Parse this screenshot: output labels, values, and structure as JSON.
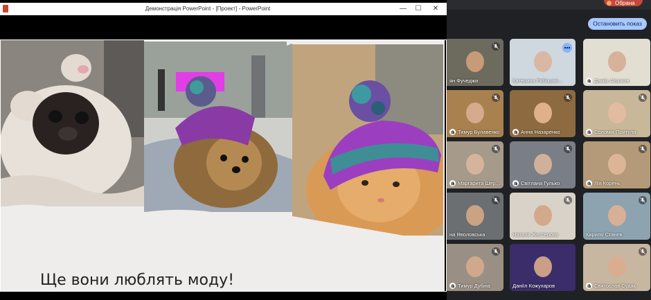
{
  "browser": {
    "account_label": "Обрана"
  },
  "ppt": {
    "window_title": "Демонстрація PowerPoint - [Проект] - PowerPoint",
    "minimize": "—",
    "maximize": "☐",
    "close": "✕",
    "slide_caption": "Ще вони люблять моду!"
  },
  "meet": {
    "stop_button": "Остановить показ",
    "participants": [
      {
        "name": "ян Фучеджи",
        "hand": false,
        "mic_off": true,
        "active": false,
        "bg": "#6d6a5e",
        "face": "#c79a78"
      },
      {
        "name": "Катерина Рябошап...",
        "hand": false,
        "mic_off": false,
        "active": true,
        "bg": "#cfd7df",
        "face": "#d9b7a2"
      },
      {
        "name": "Дамір Атроков",
        "hand": true,
        "mic_off": false,
        "active": false,
        "bg": "#e2ded2",
        "face": "#d7b19a"
      },
      {
        "name": "Тимур Булавенко",
        "hand": true,
        "mic_off": true,
        "active": false,
        "bg": "#a8814f",
        "face": "#d6ab8c"
      },
      {
        "name": "Анна Назаренко",
        "hand": true,
        "mic_off": true,
        "active": false,
        "bg": "#8d6a3f",
        "face": "#deb08b"
      },
      {
        "name": "Соломія Притула",
        "hand": true,
        "mic_off": true,
        "active": false,
        "bg": "#c9b79a",
        "face": "#e3bba3"
      },
      {
        "name": "Маргарита Шер...",
        "hand": true,
        "mic_off": true,
        "active": false,
        "bg": "#a69a8a",
        "face": "#d4b49c"
      },
      {
        "name": "Світлана Гулько",
        "hand": true,
        "mic_off": true,
        "active": false,
        "bg": "#7a7e86",
        "face": "#cfb09a"
      },
      {
        "name": "Лія Корень",
        "hand": true,
        "mic_off": true,
        "active": false,
        "bg": "#b49a78",
        "face": "#dcb597"
      },
      {
        "name": "на Яволовська",
        "hand": false,
        "mic_off": true,
        "active": false,
        "bg": "#6c6f72",
        "face": "#caa385"
      },
      {
        "name": "Наталя Жестерова",
        "hand": false,
        "mic_off": true,
        "active": false,
        "bg": "#d9d2c8",
        "face": "#d3a98d"
      },
      {
        "name": "Кирило Станєв",
        "hand": false,
        "mic_off": true,
        "active": false,
        "bg": "#8da3b0",
        "face": "#d8b095"
      },
      {
        "name": "Тимур Дубіна",
        "hand": true,
        "mic_off": true,
        "active": false,
        "bg": "#9a8f84",
        "face": "#d0a98c"
      },
      {
        "name": "Даніїл Кожухаров",
        "hand": false,
        "mic_off": false,
        "active": false,
        "bg": "#3b2d6a",
        "face": "#c99f86"
      },
      {
        "name": "Святослав Судак",
        "hand": true,
        "mic_off": true,
        "active": false,
        "bg": "#c7b6a0",
        "face": "#d9ae90"
      }
    ]
  }
}
